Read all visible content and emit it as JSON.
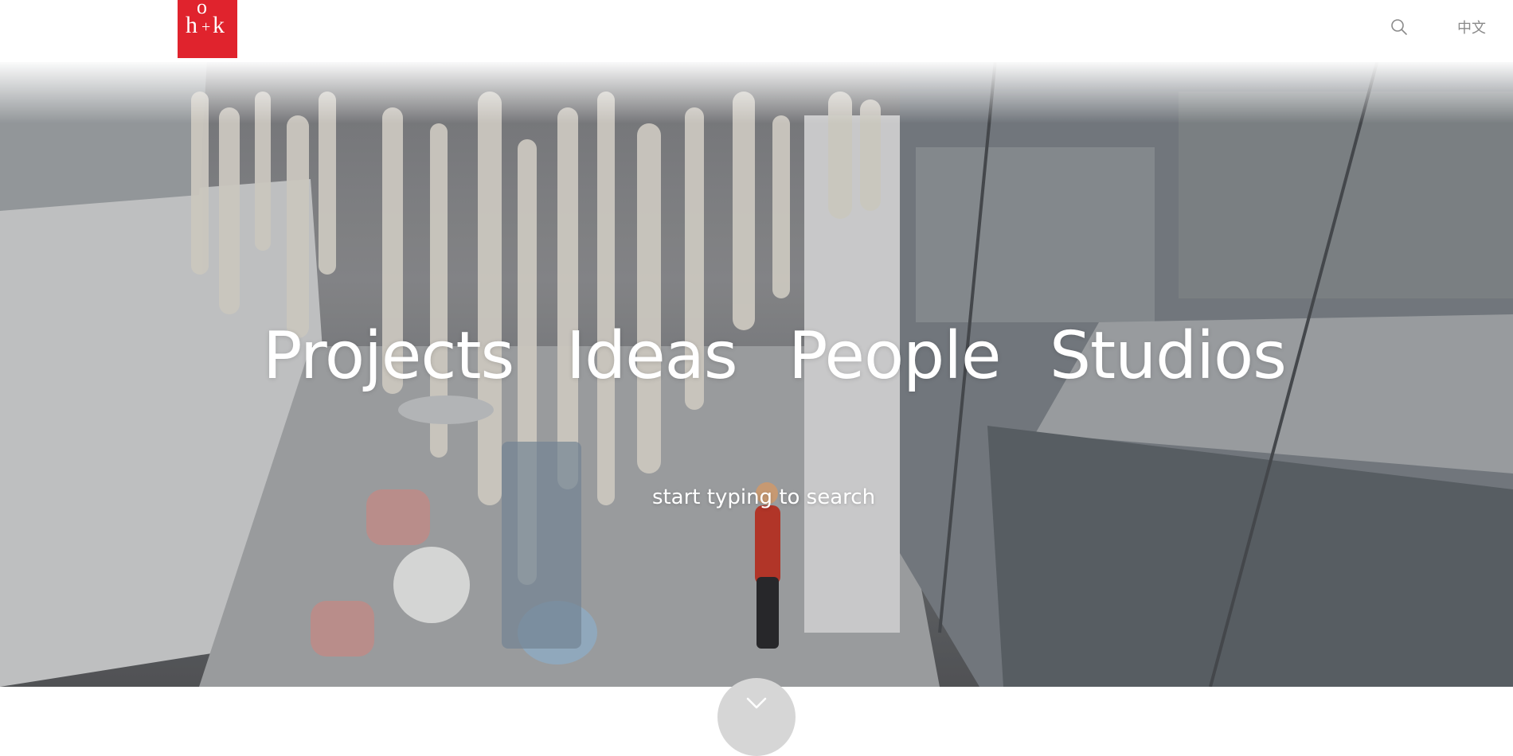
{
  "header": {
    "logo": {
      "letters": [
        "h",
        "o",
        "+",
        "k"
      ],
      "color": "#e0232d"
    },
    "search_icon": "search-icon",
    "language_label": "中文"
  },
  "hero": {
    "nav": [
      "Projects",
      "Ideas",
      "People",
      "Studios"
    ],
    "search_hint": "start typing to search",
    "scroll_icon": "chevron-down-icon"
  }
}
